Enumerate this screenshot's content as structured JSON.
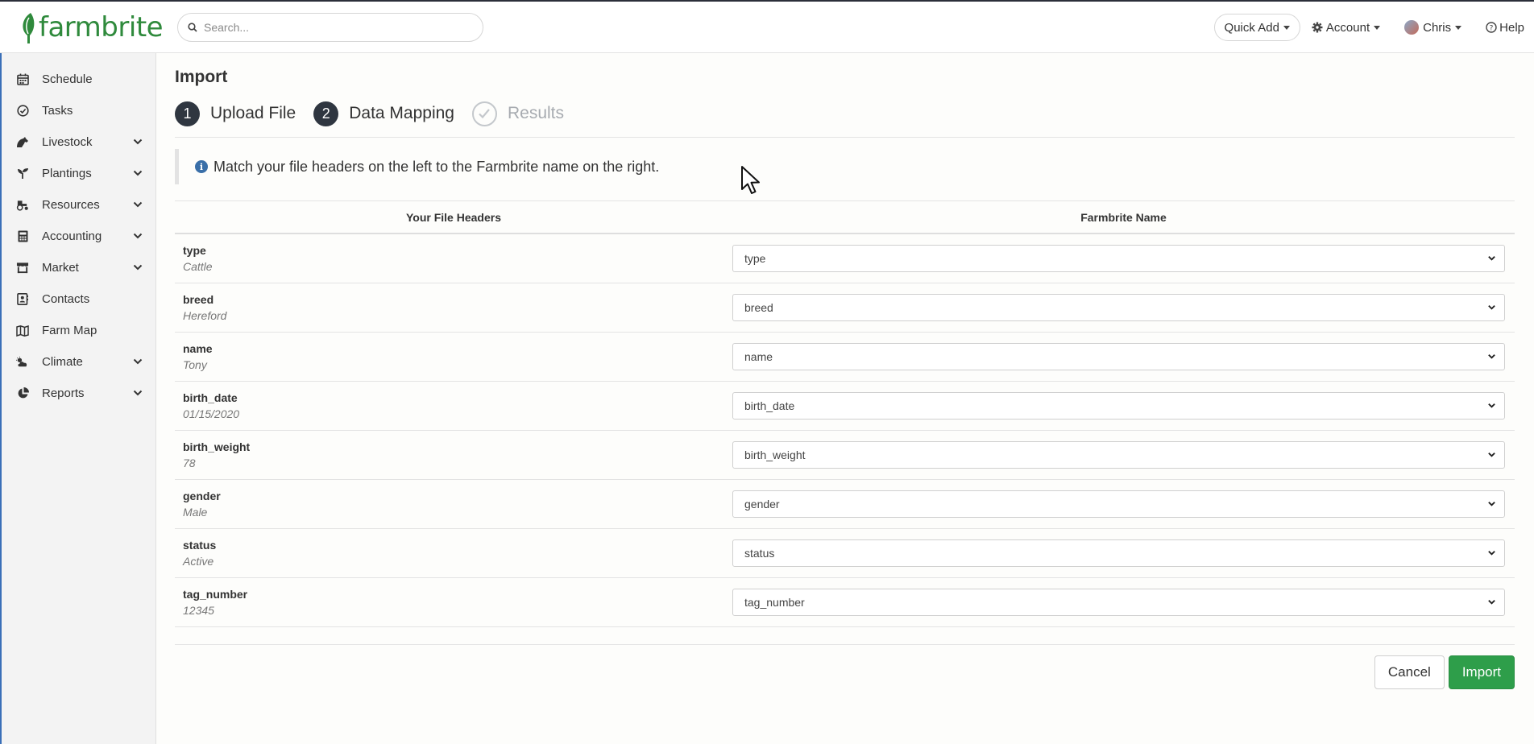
{
  "header": {
    "logo_text": "farmbrite",
    "search_placeholder": "Search...",
    "quick_add": "Quick Add",
    "account": "Account",
    "user": "Chris",
    "help": "Help"
  },
  "sidebar": {
    "items": [
      {
        "label": "Schedule",
        "icon": "calendar-icon",
        "expandable": false
      },
      {
        "label": "Tasks",
        "icon": "check-circle-icon",
        "expandable": false
      },
      {
        "label": "Livestock",
        "icon": "horse-icon",
        "expandable": true
      },
      {
        "label": "Plantings",
        "icon": "seedling-icon",
        "expandable": true
      },
      {
        "label": "Resources",
        "icon": "tractor-icon",
        "expandable": true
      },
      {
        "label": "Accounting",
        "icon": "calculator-icon",
        "expandable": true
      },
      {
        "label": "Market",
        "icon": "store-icon",
        "expandable": true
      },
      {
        "label": "Contacts",
        "icon": "address-book-icon",
        "expandable": false
      },
      {
        "label": "Farm Map",
        "icon": "map-icon",
        "expandable": false
      },
      {
        "label": "Climate",
        "icon": "cloud-sun-icon",
        "expandable": true
      },
      {
        "label": "Reports",
        "icon": "pie-chart-icon",
        "expandable": true
      }
    ]
  },
  "main": {
    "title": "Import",
    "steps": [
      {
        "num": "1",
        "label": "Upload File"
      },
      {
        "num": "2",
        "label": "Data Mapping"
      },
      {
        "num": "",
        "label": "Results"
      }
    ],
    "info": "Match your file headers on the left to the Farmbrite name on the right.",
    "table": {
      "col_left": "Your File Headers",
      "col_right": "Farmbrite Name",
      "rows": [
        {
          "header": "type",
          "sample": "Cattle",
          "mapped": "type"
        },
        {
          "header": "breed",
          "sample": "Hereford",
          "mapped": "breed"
        },
        {
          "header": "name",
          "sample": "Tony",
          "mapped": "name"
        },
        {
          "header": "birth_date",
          "sample": "01/15/2020",
          "mapped": "birth_date"
        },
        {
          "header": "birth_weight",
          "sample": "78",
          "mapped": "birth_weight"
        },
        {
          "header": "gender",
          "sample": "Male",
          "mapped": "gender"
        },
        {
          "header": "status",
          "sample": "Active",
          "mapped": "status"
        },
        {
          "header": "tag_number",
          "sample": "12345",
          "mapped": "tag_number"
        }
      ]
    },
    "cancel": "Cancel",
    "import": "Import"
  },
  "colors": {
    "brand_green": "#2f8a3c",
    "import_button": "#2e9e4a",
    "step_dark": "#2f3640",
    "info_blue": "#3a6fa8"
  }
}
